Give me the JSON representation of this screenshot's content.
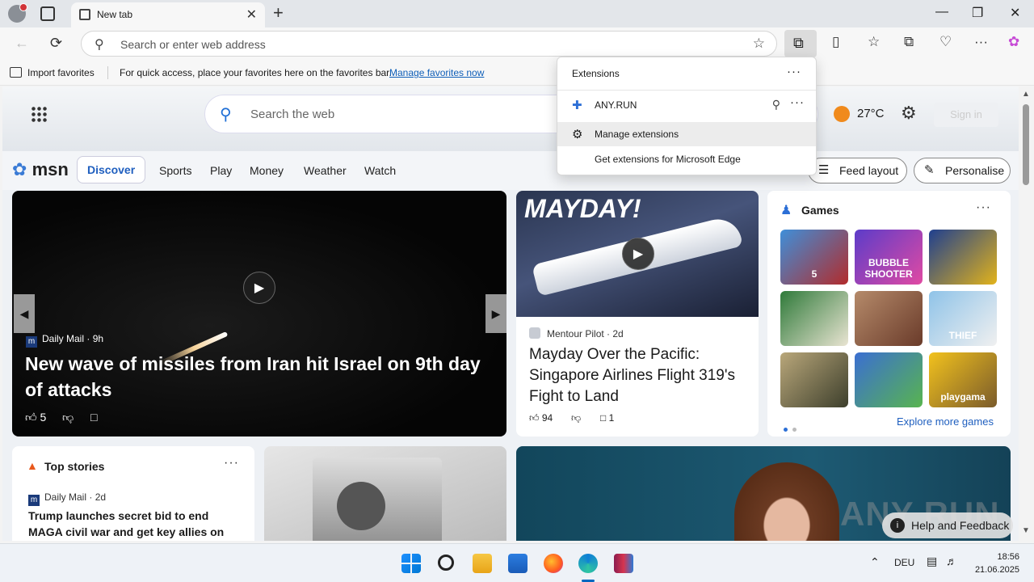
{
  "browser": {
    "tab_title": "New tab",
    "tab_close": "✕",
    "new_tab": "+",
    "window_buttons": {
      "minimize": "—",
      "restore": "❐",
      "close": "✕"
    },
    "address_placeholder": "Search or enter web address",
    "nav": {
      "back": "←",
      "refresh": "⟳"
    },
    "toolbar_icons": {
      "favorite": "☆",
      "extensions": "⧉",
      "split": "▯",
      "favorites": "☆",
      "collections": "⧉",
      "browser_essentials": "♡",
      "settings": "···",
      "copilot": "✿"
    }
  },
  "favorites_bar": {
    "import": "Import favorites",
    "hint": "For quick access, place your favorites here on the favorites bar.",
    "link": "Manage favorites now"
  },
  "extensions_popup": {
    "title": "Extensions",
    "more": "···",
    "items": [
      {
        "label": "ANY.RUN",
        "icon": "puzzle-icon",
        "glyph": "✚"
      },
      {
        "label": "Manage extensions",
        "icon": "gear-icon",
        "glyph": "⚙"
      },
      {
        "label": "Get extensions for Microsoft Edge"
      }
    ]
  },
  "msn": {
    "web_search_placeholder": "Search the web",
    "weather_temp": "27°C",
    "sign_in": "Sign in",
    "logo": "msn",
    "categories": [
      "Discover",
      "Sports",
      "Play",
      "Money",
      "Weather",
      "Watch"
    ],
    "feed_layout": "Feed layout",
    "personalise": "Personalise"
  },
  "main_story": {
    "source": "Daily Mail",
    "age": "9h",
    "headline": "New wave of missiles from Iran hit Israel on 9th day of attacks",
    "likes": "5"
  },
  "mayday_story": {
    "image_text": "MAYDAY!",
    "source": "Mentour Pilot",
    "age": "2d",
    "headline": "Mayday Over the Pacific: Singapore Airlines Flight 319's Fight to Land",
    "likes": "94",
    "comments": "1"
  },
  "games": {
    "title": "Games",
    "more": "···",
    "tiles": [
      {
        "label": "5",
        "color1": "#3f8fd9",
        "color2": "#b22b2b"
      },
      {
        "label": "BUBBLE SHOOTER",
        "color1": "#5c3cc9",
        "color2": "#e04aa3"
      },
      {
        "label": "",
        "color1": "#1f3f8f",
        "color2": "#e2b31b"
      },
      {
        "label": "",
        "color1": "#2f7a3a",
        "color2": "#e9e4d2"
      },
      {
        "label": "",
        "color1": "#b58a6a",
        "color2": "#6a3b2a"
      },
      {
        "label": "THIEF",
        "color1": "#8fc3e8",
        "color2": "#f0f0f0"
      },
      {
        "label": "",
        "color1": "#b9a77a",
        "color2": "#3d3f2c"
      },
      {
        "label": "",
        "color1": "#3b6fd1",
        "color2": "#58b44f"
      },
      {
        "label": "playgama",
        "color1": "#f2c21d",
        "color2": "#7a5b2b"
      }
    ],
    "explore": "Explore more games"
  },
  "top_stories": {
    "title": "Top stories",
    "source": "Daily Mail",
    "age": "2d",
    "headline": "Trump launches secret bid to end MAGA civil war and get key allies on board wit..."
  },
  "overlays": {
    "watermark": "ANY RUN",
    "help": "Help and Feedback"
  },
  "taskbar": {
    "language": "DEU",
    "time": "18:56",
    "date": "21.06.2025"
  }
}
